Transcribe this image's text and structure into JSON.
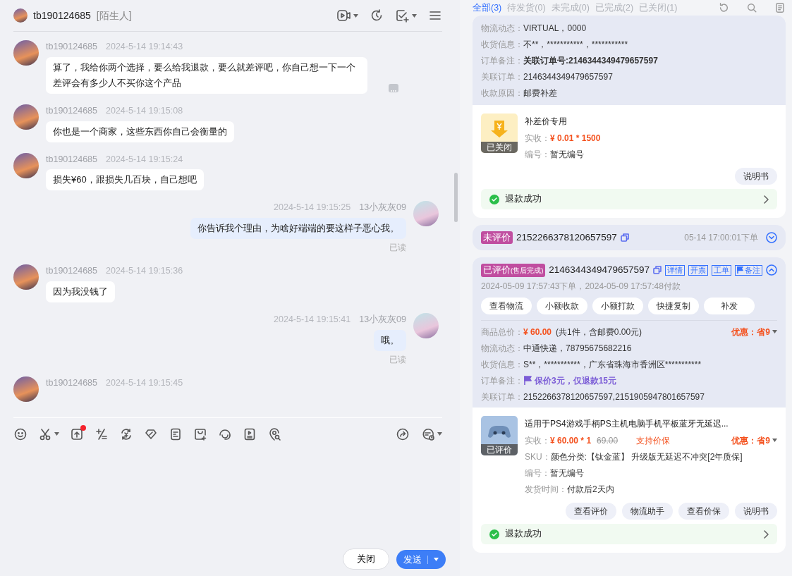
{
  "chat": {
    "contact": {
      "name": "tb190124685",
      "tag": "[陌生人]"
    },
    "messages": [
      {
        "kind": "in",
        "sender": "tb190124685",
        "time": "2024-5-14 19:14:43",
        "text": "算了，我给你两个选择，要么给我退款，要么就差评吧，你自己想一下一个差评会有多少人不买你这个产品",
        "more_button": true
      },
      {
        "kind": "in",
        "sender": "tb190124685",
        "time": "2024-5-14 19:15:08",
        "text": "你也是一个商家，这些东西你自己会衡量的"
      },
      {
        "kind": "in",
        "sender": "tb190124685",
        "time": "2024-5-14 19:15:24",
        "text": "损失¥60，跟损失几百块，自己想吧"
      },
      {
        "kind": "out",
        "sender": "13小灰灰09",
        "time": "2024-5-14 19:15:25",
        "text": "你告诉我个理由，为啥好端端的要这样子恶心我。",
        "status": "已读"
      },
      {
        "kind": "in",
        "sender": "tb190124685",
        "time": "2024-5-14 19:15:36",
        "text": "因为我没钱了"
      },
      {
        "kind": "out",
        "sender": "13小灰灰09",
        "time": "2024-5-14 19:15:41",
        "text": "哦。",
        "status": "已读"
      },
      {
        "kind": "in",
        "sender": "tb190124685",
        "time": "2024-5-14 19:15:45"
      }
    ],
    "toolbar": {
      "upload_dot": true
    },
    "buttons": {
      "close": "关闭",
      "send": "发送"
    }
  },
  "orders": {
    "tabs": [
      {
        "label": "全部(3)",
        "selected": true
      },
      {
        "label": "待发货(0)",
        "selected": false
      },
      {
        "label": "未完成(0)",
        "selected": false
      },
      {
        "label": "已完成(2)",
        "selected": false
      },
      {
        "label": "已关闭(1)",
        "selected": false
      }
    ],
    "cards": [
      {
        "kind": "partial",
        "info": [
          {
            "kind": "plain",
            "label": "物流动态：",
            "value": "VIRTUAL，0000"
          },
          {
            "kind": "plain",
            "label": "收货信息：",
            "value": "不**，***********，***********"
          },
          {
            "kind": "bold",
            "label": "订单备注：",
            "value": "关联订单号:2146344349479657597"
          },
          {
            "kind": "plain",
            "label": "关联订单：",
            "value": "2146344349479657597"
          },
          {
            "kind": "plain",
            "label": "收款原因：",
            "value": "邮费补差"
          }
        ],
        "product": {
          "thumb": {
            "kind": "coin",
            "status": "已关闭"
          },
          "title": "补差价专用",
          "rows": [
            {
              "kind": "price",
              "label": "实收：",
              "value": "¥ 0.01 * 1500"
            },
            {
              "kind": "plain",
              "label": "编号：",
              "value": "暂无编号"
            }
          ]
        },
        "buttons": [
          "说明书"
        ],
        "refund": "退款成功"
      },
      {
        "kind": "order",
        "expanded": false,
        "badge": "未评价",
        "order_no": "2152266378120657597",
        "time": "05-14 17:00:01下单"
      },
      {
        "kind": "order",
        "expanded": true,
        "badge": "已评价",
        "badge_note": "(售后完成)",
        "order_no": "2146344349479657597",
        "links": [
          {
            "label": "详情",
            "flag": false
          },
          {
            "label": "开票",
            "flag": false
          },
          {
            "label": "工单",
            "flag": false
          },
          {
            "label": "备注",
            "flag": true
          }
        ],
        "times": "2024-05-09 17:57:43下单，2024-05-09 17:57:48付款",
        "actions": [
          "查看物流",
          "小额收款",
          "小额打款",
          "快捷复制",
          "补发"
        ],
        "info": [
          {
            "kind": "price",
            "label": "商品总价：",
            "value": "¥ 60.00",
            "note": "(共1件，含邮费0.00元)",
            "discount": "优惠：省9"
          },
          {
            "kind": "plain",
            "label": "物流动态：",
            "value": "中通快递，78795675682216"
          },
          {
            "kind": "plain",
            "label": "收货信息：",
            "value": "S**，***********，广东省珠海市香洲区***********"
          },
          {
            "kind": "flag",
            "label": "订单备注：",
            "value": "保价3元，仅退款15元"
          },
          {
            "kind": "plain",
            "label": "关联订单：",
            "value": "2152266378120657597,2151905947801657597"
          }
        ],
        "product": {
          "thumb": {
            "kind": "photo",
            "status": "已评价"
          },
          "title": "适用于PS4游戏手柄PS主机电脑手机平板蓝牙无延迟...",
          "rows": [
            {
              "kind": "price",
              "label": "实收：",
              "value": "¥ 60.00 * 1",
              "original": "69.00",
              "guarantee": "支持价保",
              "discount": "优惠：省9"
            },
            {
              "kind": "plain",
              "label": "SKU：",
              "value": "颜色分类:【钛金蓝】 升级版无延迟不冲突[2年质保]"
            },
            {
              "kind": "plain",
              "label": "编号：",
              "value": "暂无编号"
            },
            {
              "kind": "plain",
              "label": "发货时间：",
              "value": "付款后2天内"
            }
          ]
        },
        "buttons": [
          "查看评价",
          "物流助手",
          "查看价保",
          "说明书"
        ],
        "refund": "退款成功"
      }
    ]
  }
}
